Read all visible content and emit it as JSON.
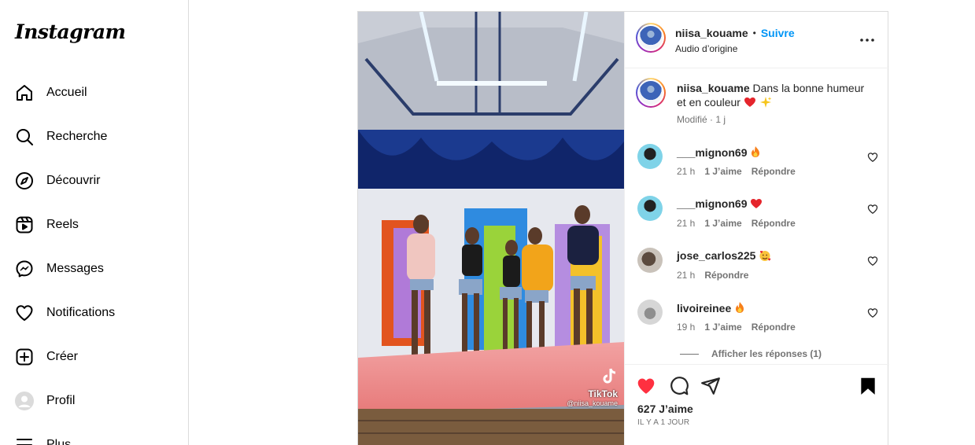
{
  "app": {
    "logo": "Instagram"
  },
  "sidebar": {
    "items": [
      {
        "label": "Accueil",
        "icon": "home-icon"
      },
      {
        "label": "Recherche",
        "icon": "search-icon"
      },
      {
        "label": "Découvrir",
        "icon": "compass-icon"
      },
      {
        "label": "Reels",
        "icon": "reels-icon"
      },
      {
        "label": "Messages",
        "icon": "messenger-icon"
      },
      {
        "label": "Notifications",
        "icon": "heart-icon"
      },
      {
        "label": "Créer",
        "icon": "plus-square-icon"
      },
      {
        "label": "Profil",
        "icon": "avatar"
      },
      {
        "label": "Plus",
        "icon": "menu-icon"
      }
    ]
  },
  "post": {
    "author": "niisa_kouame",
    "follow_label": "Suivre",
    "separator": "•",
    "audio": "Audio d’origine",
    "caption_text": "Dans la bonne humeur et en couleur",
    "caption_emojis": [
      "red-heart",
      "sparkles"
    ],
    "caption_meta": "Modifié · 1 j",
    "video_watermark": {
      "brand": "TikTok",
      "handle": "@niisa_kouame"
    },
    "likes": "627 J’aime",
    "date": "IL Y A 1 JOUR",
    "view_replies": "Afficher les réponses (1)"
  },
  "comments": [
    {
      "user": "___mignon69",
      "emoji": "fire",
      "time": "21 h",
      "likes": "1 J’aime",
      "reply": "Répondre"
    },
    {
      "user": "___mignon69",
      "emoji": "red-heart",
      "time": "21 h",
      "likes": "1 J’aime",
      "reply": "Répondre"
    },
    {
      "user": "jose_carlos225",
      "emoji": "smiling-hearts",
      "time": "21 h",
      "likes": "",
      "reply": "Répondre"
    },
    {
      "user": "livoireinee",
      "emoji": "fire",
      "time": "19 h",
      "likes": "1 J’aime",
      "reply": "Répondre"
    }
  ],
  "colors": {
    "accent_blue": "#0095f6",
    "like_red": "#ff3040",
    "muted": "#737373",
    "border": "#dbdbdb"
  }
}
